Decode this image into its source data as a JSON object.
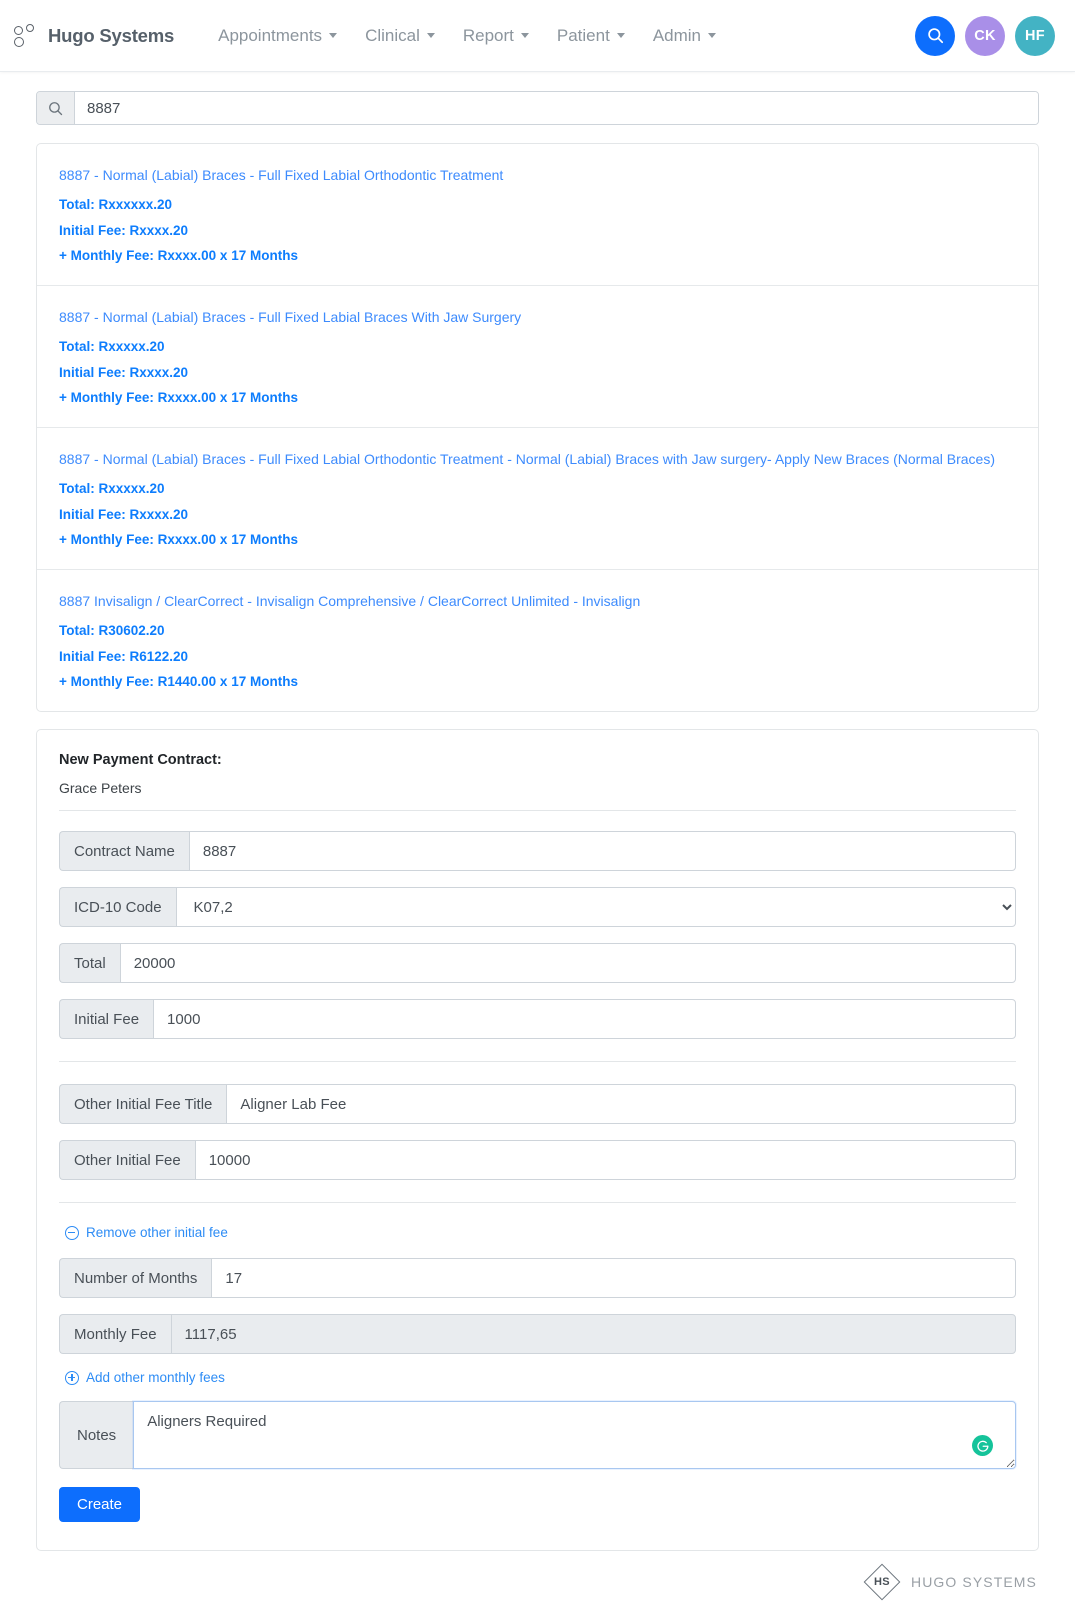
{
  "navbar": {
    "brand": "Hugo Systems",
    "menu": [
      {
        "label": "Appointments"
      },
      {
        "label": "Clinical"
      },
      {
        "label": "Report"
      },
      {
        "label": "Patient"
      },
      {
        "label": "Admin"
      }
    ],
    "actions": {
      "search_icon": "search-icon",
      "avatar_1": {
        "initials": "CK",
        "color": "#a98fe8"
      },
      "avatar_2": {
        "initials": "HF",
        "color": "#43b3c4"
      },
      "search_color": "#0d6efd"
    }
  },
  "search": {
    "value": "8887",
    "placeholder": "",
    "icon": "search-icon"
  },
  "results": [
    {
      "title": "8887 - Normal (Labial) Braces - Full Fixed Labial Orthodontic Treatment",
      "total": "Total: Rxxxxxx.20",
      "initial_fee": "Initial Fee: Rxxxx.20",
      "monthly_fee": "+ Monthly Fee: Rxxxx.00 x 17 Months"
    },
    {
      "title": "8887 - Normal (Labial) Braces - Full Fixed Labial Braces With Jaw Surgery",
      "total": "Total: Rxxxxx.20",
      "initial_fee": "Initial Fee: Rxxxx.20",
      "monthly_fee": "+ Monthly Fee: Rxxxx.00 x 17 Months"
    },
    {
      "title": "8887 - Normal (Labial) Braces - Full Fixed Labial Orthodontic Treatment - Normal (Labial) Braces with Jaw surgery- Apply New Braces (Normal Braces)",
      "total": "Total: Rxxxxx.20",
      "initial_fee": "Initial Fee: Rxxxx.20",
      "monthly_fee": "+ Monthly Fee: Rxxxx.00 x 17 Months"
    },
    {
      "title": "8887 Invisalign / ClearCorrect - Invisalign Comprehensive / ClearCorrect Unlimited - Invisalign",
      "total": "Total: R30602.20",
      "initial_fee": "Initial Fee: R6122.20",
      "monthly_fee": "+ Monthly Fee: R1440.00 x 17 Months"
    }
  ],
  "form": {
    "heading": "New Payment Contract:",
    "patient_name": "Grace Peters",
    "fields": {
      "contract_name": {
        "label": "Contract Name",
        "value": "8887"
      },
      "icd10": {
        "label": "ICD-10 Code",
        "value": "K07,2"
      },
      "total": {
        "label": "Total",
        "value": "20000"
      },
      "initial_fee": {
        "label": "Initial Fee",
        "value": "1000"
      },
      "other_initial_fee_title": {
        "label": "Other Initial Fee Title",
        "value": "Aligner Lab Fee"
      },
      "other_initial_fee": {
        "label": "Other Initial Fee",
        "value": "10000"
      },
      "number_of_months": {
        "label": "Number of Months",
        "value": "17"
      },
      "monthly_fee": {
        "label": "Monthly Fee",
        "value": "1117,65"
      },
      "notes": {
        "label": "Notes",
        "value": "Aligners Required"
      }
    },
    "links": {
      "remove_other_initial_fee": "Remove other initial fee",
      "add_other_monthly_fees": "Add other monthly fees"
    },
    "submit_label": "Create",
    "grammarly_icon": "grammarly-icon"
  },
  "footer": {
    "logo_initials": "HS",
    "name": "HUGO SYSTEMS"
  }
}
